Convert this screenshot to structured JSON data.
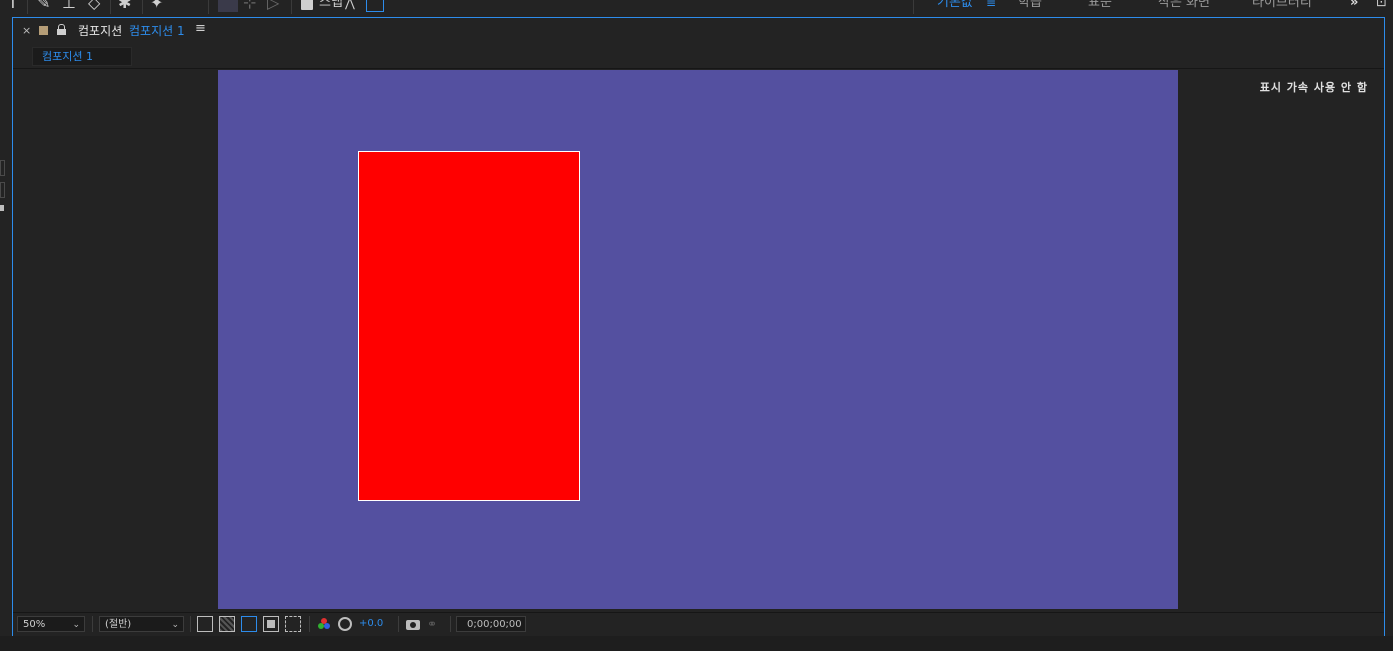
{
  "toolbar": {
    "snap_label": "스냅",
    "workspaces": [
      {
        "label": "기본값",
        "active": true
      },
      {
        "label": "학습",
        "active": false
      },
      {
        "label": "표준",
        "active": false
      },
      {
        "label": "작은 화면",
        "active": false
      },
      {
        "label": "라이브러리",
        "active": false
      }
    ],
    "more_label": "»"
  },
  "panel": {
    "close_label": "×",
    "title_prefix": "컴포지션",
    "title_name": "컴포지션 1",
    "menu_label": "≡",
    "subtab_label": "컴포지션 1"
  },
  "viewer": {
    "gpu_status": "표시 가속 사용 안 함",
    "background_color": "#5450a0",
    "layer_color": "#ff0000"
  },
  "footer": {
    "zoom": "50%",
    "resolution": "(절반)",
    "exposure": "+0.0",
    "timecode": "0;00;00;00"
  },
  "colors": {
    "accent": "#2d8ceb",
    "panel_bg": "#232323"
  }
}
